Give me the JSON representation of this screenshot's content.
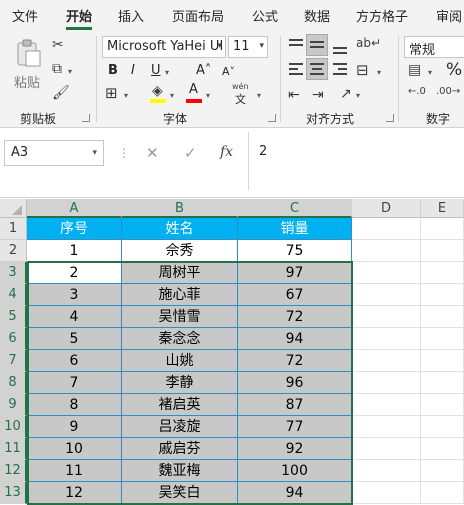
{
  "menu": {
    "tabs": [
      "文件",
      "开始",
      "插入",
      "页面布局",
      "公式",
      "数据",
      "方方格子",
      "审阅"
    ],
    "active": "开始"
  },
  "ribbon": {
    "clipboard": {
      "paste_label": "粘贴",
      "group_label": "剪贴板"
    },
    "font": {
      "name": "Microsoft YaHei UI",
      "size": "11",
      "bold": "B",
      "italic": "I",
      "underline": "U",
      "grow": "A˄",
      "shrink": "A˅",
      "phonetic_top": "wén",
      "phonetic_bottom": "文",
      "highlight_color": "#ffff00",
      "font_color": "#ff0000",
      "group_label": "字体"
    },
    "alignment": {
      "group_label": "对齐方式"
    },
    "number": {
      "format": "常规",
      "percent": "%",
      "group_label": "数字"
    }
  },
  "formula_bar": {
    "name_box": "A3",
    "cancel": "✕",
    "enter": "✓",
    "fx": "fx",
    "value": "2"
  },
  "sheet": {
    "columns": [
      "A",
      "B",
      "C",
      "D",
      "E"
    ],
    "rows": [
      "1",
      "2",
      "3",
      "4",
      "5",
      "6",
      "7",
      "8",
      "9",
      "10",
      "11",
      "12",
      "13"
    ],
    "header": [
      "序号",
      "姓名",
      "销量"
    ],
    "data": [
      [
        "1",
        "佘秀",
        "75"
      ],
      [
        "2",
        "周树平",
        "97"
      ],
      [
        "3",
        "施心菲",
        "67"
      ],
      [
        "4",
        "吴惜雪",
        "72"
      ],
      [
        "5",
        "秦念念",
        "94"
      ],
      [
        "6",
        "山姚",
        "72"
      ],
      [
        "7",
        "李静",
        "96"
      ],
      [
        "8",
        "褚启英",
        "87"
      ],
      [
        "9",
        "吕凌旋",
        "77"
      ],
      [
        "10",
        "戚启芬",
        "92"
      ],
      [
        "11",
        "魏亚梅",
        "100"
      ],
      [
        "12",
        "吴笑白",
        "94"
      ]
    ],
    "header_fill": "#00b0f0",
    "selection_fill": "#c8c8c8",
    "selection_border": "#217346"
  }
}
